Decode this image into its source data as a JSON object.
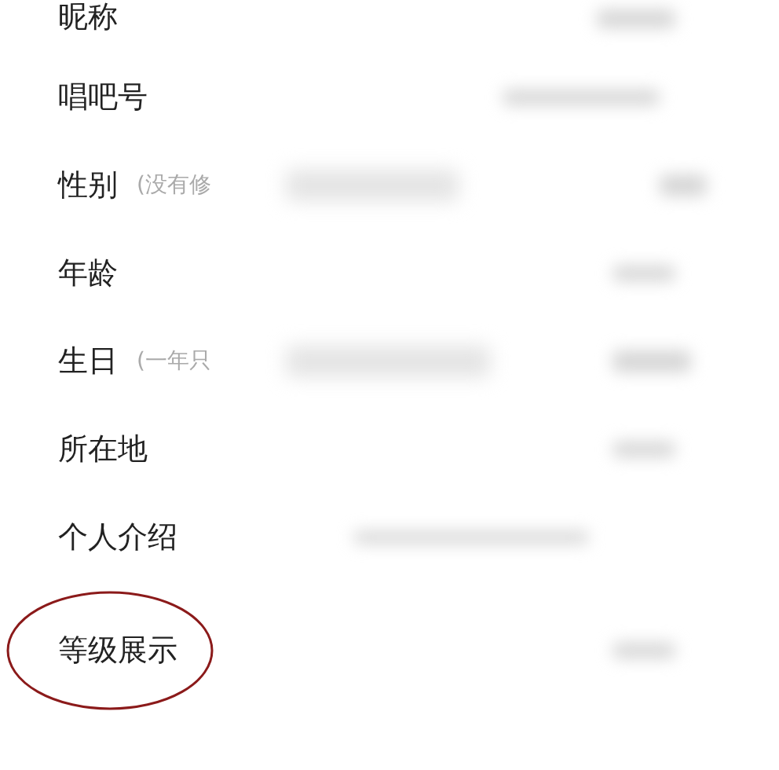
{
  "rows": [
    {
      "label": "昵称",
      "highlighted": false
    },
    {
      "label": "唱吧号",
      "highlighted": false
    },
    {
      "label": "性别",
      "note": "(没有修",
      "highlighted": false
    },
    {
      "label": "年龄",
      "highlighted": false
    },
    {
      "label": "生日",
      "note": "(一年只",
      "highlighted": false
    },
    {
      "label": "所在地",
      "highlighted": false
    },
    {
      "label": "个人介绍",
      "highlighted": false
    },
    {
      "label": "等级展示",
      "highlighted": true
    }
  ]
}
